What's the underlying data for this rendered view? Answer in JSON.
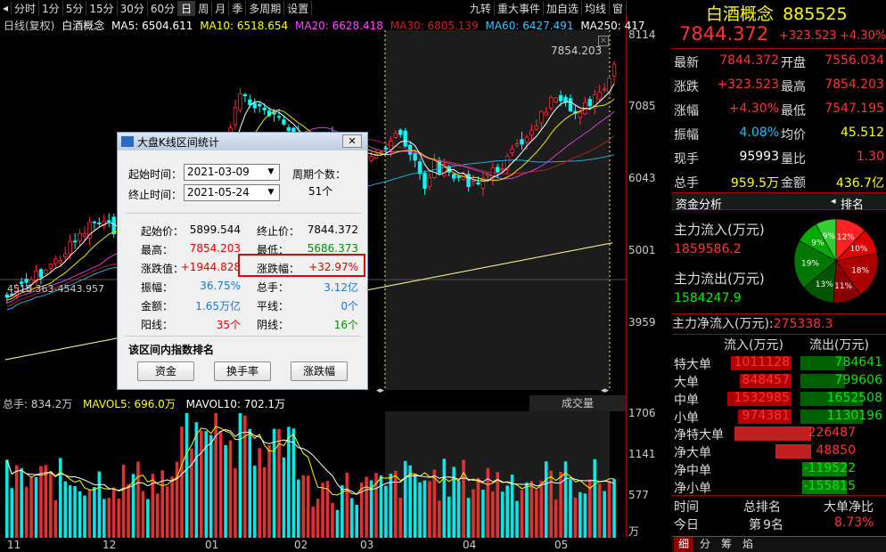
{
  "toolbar": {
    "items": [
      "分时",
      "1分",
      "5分",
      "15分",
      "30分",
      "60分",
      "日",
      "周",
      "月",
      "季",
      "多周期",
      "设置"
    ],
    "right_items": [
      "九转",
      "重大事件",
      "加自选",
      "均线",
      "窗"
    ]
  },
  "legend": {
    "mode": "日线(复权)",
    "name": "白酒概念",
    "ma5": "MA5: 6504.611",
    "ma10": "MA10: 6518.654",
    "ma20": "MA20: 6628.418",
    "ma30": "MA30: 6805.139",
    "ma60": "MA60: 6427.491",
    "ma250": "MA250: 417"
  },
  "price_axis": [
    "8114",
    "7085",
    "6043",
    "5001",
    "3959"
  ],
  "vol_axis": [
    "1706",
    "1141",
    "577",
    "万"
  ],
  "x_axis": [
    "11",
    "12",
    "01",
    "02",
    "03",
    "04",
    "05"
  ],
  "peak_label": "7854.203",
  "low_label": "4518.363-4543.957",
  "vol_header": {
    "total": "总手: 834.2万",
    "mavol5": "MAVOL5: 696.0万",
    "mavol10": "MAVOL10: 702.1万",
    "tab": "成交量"
  },
  "dialog": {
    "title": "大盘K线区间统计",
    "start_label": "起始时间：",
    "start_value": "2021-03-09",
    "end_label": "终止时间：",
    "end_value": "2021-05-24",
    "period_label": "周期个数：",
    "period_value": "51个",
    "stats": [
      {
        "l": "起始价：",
        "v": "5899.544",
        "l2": "终止价：",
        "v2": "7844.372"
      },
      {
        "l": "最高：",
        "v": "7854.203",
        "l2": "最低：",
        "v2": "5686.373"
      },
      {
        "l": "涨跌值：",
        "v": "+1944.828",
        "l2": "涨跌幅：",
        "v2": "+32.97%"
      },
      {
        "l": "振幅：",
        "v": "36.75%",
        "l2": "总手：",
        "v2": "3.12亿"
      },
      {
        "l": "金额：",
        "v": "1.65万亿",
        "l2": "平线：",
        "v2": "0个"
      },
      {
        "l": "阳线：",
        "v": "35个",
        "l2": "阴线：",
        "v2": "16个"
      }
    ],
    "rank_title": "该区间内指数排名",
    "buttons": [
      "资金",
      "换手率",
      "涨跌幅"
    ]
  },
  "panel": {
    "name": "白酒概念",
    "code": "885525",
    "price": "7844.372",
    "change": "+323.523",
    "pct": "+4.30%",
    "quotes": [
      {
        "l": "最新",
        "v": "7844.372",
        "c": "red",
        "l2": "开盘",
        "v2": "7556.034",
        "c2": "red"
      },
      {
        "l": "涨跌",
        "v": "+323.523",
        "c": "red",
        "l2": "最高",
        "v2": "7854.203",
        "c2": "red"
      },
      {
        "l": "涨幅",
        "v": "+4.30%",
        "c": "red",
        "l2": "最低",
        "v2": "7547.195",
        "c2": "red"
      },
      {
        "l": "振幅",
        "v": "4.08%",
        "c": "cyan",
        "l2": "均价",
        "v2": "45.512",
        "c2": "yellow"
      },
      {
        "l": "现手",
        "v": "95993",
        "c": "white",
        "l2": "量比",
        "v2": "1.30",
        "c2": "red"
      },
      {
        "l": "总手",
        "v": "959.5万",
        "c": "yellow",
        "l2": "金额",
        "v2": "436.7亿",
        "c2": "yellow"
      }
    ],
    "fund_tab": "资金分析",
    "rank_tab": "排名",
    "inflow_label": "主力流入(万元)",
    "inflow": "1859586.2",
    "outflow_label": "主力流出(万元)",
    "outflow": "1584247.9",
    "net_label": "主力净流入(万元):",
    "net": "275338.3",
    "pie_labels": [
      "9%",
      "12%",
      "10%",
      "18%",
      "11%",
      "13%",
      "19%",
      "9%"
    ],
    "col_in": "流入(万元)",
    "col_out": "流出(万元)",
    "flows": [
      {
        "l": "特大单",
        "in": "1011128",
        "out": "784641"
      },
      {
        "l": "大单",
        "in": "848457",
        "out": "799606"
      },
      {
        "l": "中单",
        "in": "1532985",
        "out": "1652508"
      },
      {
        "l": "小单",
        "in": "974381",
        "out": "1130196"
      }
    ],
    "nets": [
      {
        "l": "净特大单",
        "v": "226487"
      },
      {
        "l": "净大单",
        "v": "48850"
      },
      {
        "l": "净中单",
        "v": "-119522"
      },
      {
        "l": "净小单",
        "v": "-155815"
      }
    ],
    "bottom": {
      "time": "时间",
      "rank": "总排名",
      "ratio": "大单净比",
      "today": "今日",
      "today_rank": "第",
      "today_rank2": "9名",
      "today_ratio": "8.73%"
    },
    "tabs": [
      "细",
      "分",
      "筹",
      "焰"
    ]
  }
}
